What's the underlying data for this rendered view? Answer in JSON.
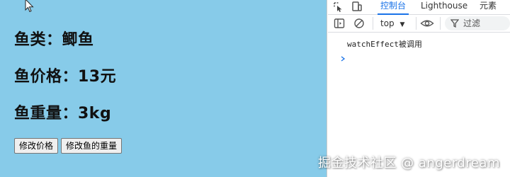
{
  "page": {
    "background_color": "#87cbe9",
    "fish_type": "鱼类：鲫鱼",
    "fish_price": "鱼价格：13元",
    "fish_weight": "鱼重量：3kg",
    "buttons": {
      "change_price": "修改价格",
      "change_weight": "修改鱼的重量"
    }
  },
  "devtools": {
    "tabs": [
      "控制台",
      "Lighthouse",
      "元素"
    ],
    "active_tab": "控制台",
    "accent_color": "#1a73e8",
    "toolbar": {
      "context": "top",
      "filter_label": "过滤"
    },
    "console": {
      "messages": [
        "watchEffect被调用"
      ]
    }
  },
  "watermark": "掘金技术社区 @ angerdream"
}
